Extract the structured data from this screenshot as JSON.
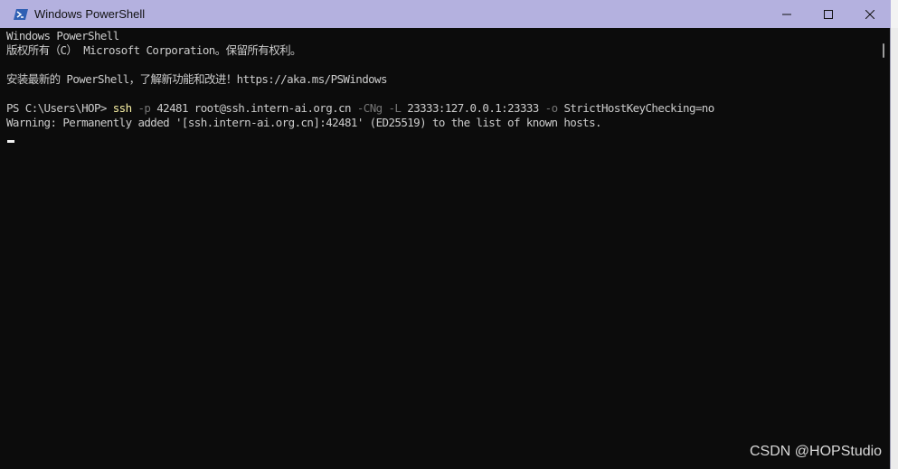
{
  "window": {
    "title": "Windows PowerShell",
    "icon": "powershell-icon",
    "controls": [
      "minimize-icon",
      "maximize-icon",
      "close-icon"
    ]
  },
  "console": {
    "line1": "Windows PowerShell",
    "line2": "版权所有（C） Microsoft Corporation。保留所有权利。",
    "line3": "安装最新的 PowerShell，了解新功能和改进！https://aka.ms/PSWindows",
    "prompt": {
      "prefix": "PS C:\\Users\\HOP> ",
      "cmd": "ssh",
      "flag_p": " -p",
      "port": " 42481 root@ssh.intern-ai.org.cn",
      "flag_cng": " -CNg",
      "flag_l": " -L",
      "forward": " 23333:127.0.0.1:23333",
      "flag_o": " -o",
      "option": " StrictHostKeyChecking=no"
    },
    "warning": "Warning: Permanently added '[ssh.intern-ai.org.cn]:42481' (ED25519) to the list of known hosts."
  },
  "watermark": "CSDN @HOPStudio",
  "colors": {
    "titlebar": "#b4b1df",
    "console_bg": "#0c0c0c",
    "console_text": "#cccccc",
    "command_yellow": "#f9f1a5",
    "param_gray": "#767676"
  }
}
